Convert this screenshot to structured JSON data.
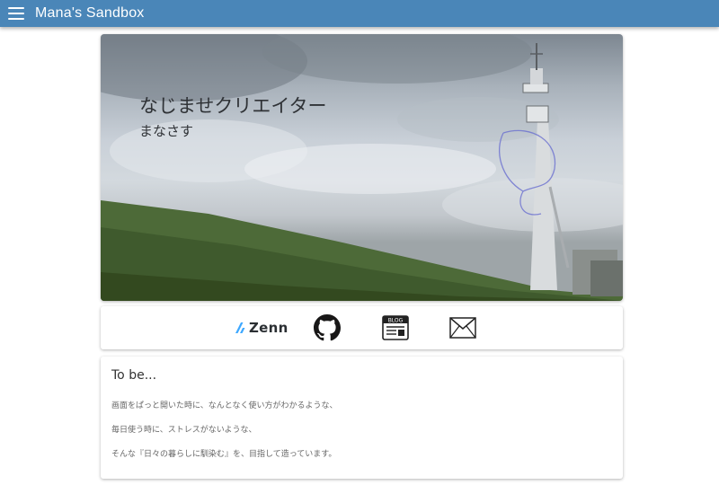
{
  "app": {
    "title": "Mana's Sandbox"
  },
  "hero": {
    "title": "なじませクリエイター",
    "subtitle": "まなさす"
  },
  "links": {
    "zenn_label": "Zenn",
    "blog_badge": "BLOG",
    "icons": [
      "zenn-icon",
      "github-icon",
      "blog-icon",
      "mail-icon"
    ]
  },
  "about": {
    "heading": "To be...",
    "lines": [
      "画面をぱっと開いた時に、なんとなく使い方がわかるような、",
      "毎日使う時に、ストレスがないような、",
      "そんな『日々の暮らしに馴染む』を、目指して造っています。"
    ]
  },
  "colors": {
    "app_bar": "#4a86b8",
    "app_title": "#ffffff",
    "page_background": "#ffffff"
  }
}
